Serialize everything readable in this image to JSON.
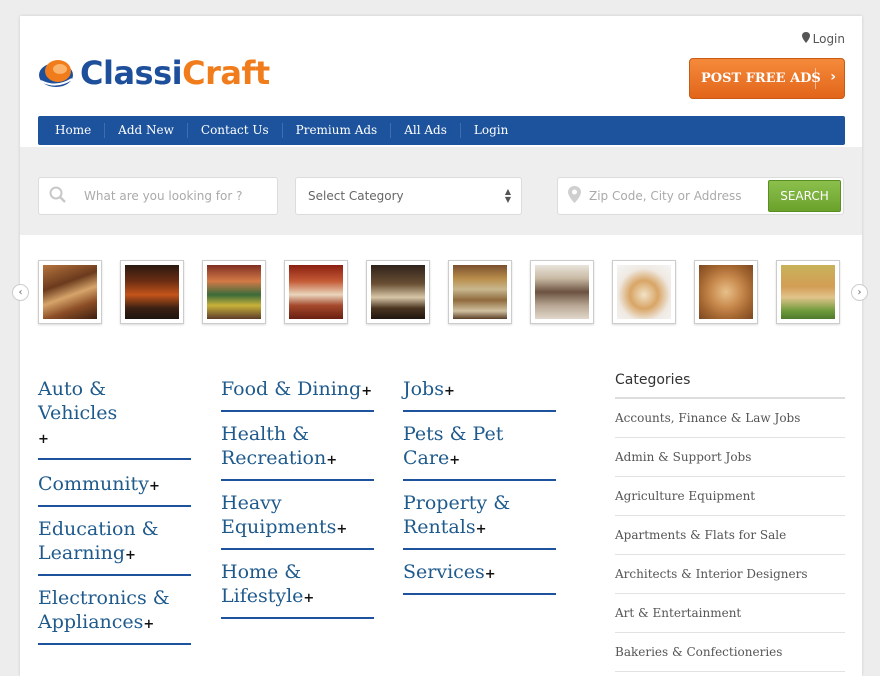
{
  "header": {
    "logo_part1": "Classi",
    "logo_part2": "Craft",
    "login_link": "Login",
    "post_button": "POST FREE ADS"
  },
  "nav": [
    "Home",
    "Add New",
    "Contact Us",
    "Premium Ads",
    "All Ads",
    "Login"
  ],
  "search": {
    "keyword_placeholder": "What are you looking for ?",
    "category_selected": "Select Category",
    "location_placeholder": "Zip Code, City or Address",
    "button": "SEARCH"
  },
  "carousel": {
    "thumbnails": [
      "bakery-display",
      "restaurant-storefront",
      "street-market",
      "dining-room",
      "restaurant-interior",
      "candy-shop",
      "confectionery-counter",
      "puppy",
      "puppy-closeup",
      "kitten-and-puppy"
    ]
  },
  "categories": {
    "col1": [
      {
        "name": "Auto & Vehicles",
        "plus": "+"
      },
      {
        "name": "Community",
        "plus": "+"
      },
      {
        "name": "Education & Learning",
        "plus": "+"
      },
      {
        "name": "Electronics & Appliances",
        "plus": "+"
      }
    ],
    "col2": [
      {
        "name": "Food & Dining",
        "plus": "+"
      },
      {
        "name": "Health & Recreation",
        "plus": "+"
      },
      {
        "name": "Heavy Equipments",
        "plus": "+"
      },
      {
        "name": "Home & Lifestyle",
        "plus": "+"
      }
    ],
    "col3": [
      {
        "name": "Jobs",
        "plus": "+"
      },
      {
        "name": "Pets & Pet Care",
        "plus": "+"
      },
      {
        "name": "Property & Rentals",
        "plus": "+"
      },
      {
        "name": "Services",
        "plus": "+"
      }
    ]
  },
  "sidebar": {
    "title": "Categories",
    "items": [
      "Accounts, Finance & Law Jobs",
      "Admin & Support Jobs",
      "Agriculture Equipment",
      "Apartments & Flats for Sale",
      "Architects & Interior Designers",
      "Art & Entertainment",
      "Bakeries & Confectioneries"
    ]
  },
  "colors": {
    "brand_blue": "#1d539c",
    "brand_orange": "#f07c1b",
    "search_green": "#7ab33c"
  }
}
